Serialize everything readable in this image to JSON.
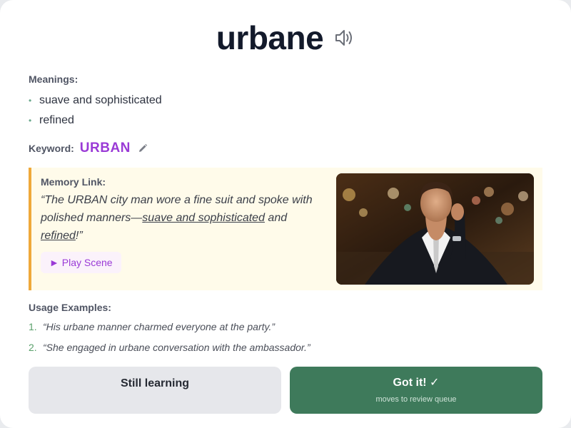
{
  "word": "urbane",
  "meanings_label": "Meanings:",
  "meanings": [
    "suave and sophisticated",
    "refined"
  ],
  "keyword_label": "Keyword:",
  "keyword": "URBAN",
  "memory": {
    "label": "Memory Link:",
    "text_parts": [
      "“The URBAN city man wore a fine suit and spoke with polished manners—",
      "suave and sophisticated",
      " and ",
      "refined",
      "!”"
    ],
    "play_label": "► Play Scene",
    "image_alt": "Man in a dark suit on a city street at night"
  },
  "usage_label": "Usage Examples:",
  "examples": [
    {
      "num": "1.",
      "text": "“His urbane manner charmed everyone at the party.”"
    },
    {
      "num": "2.",
      "text": "“She engaged in urbane conversation with the ambassador.”"
    }
  ],
  "buttons": {
    "still_learning": "Still learning",
    "got_it": "Got it! ✓",
    "got_it_sub": "moves to review queue"
  },
  "colors": {
    "keyword": "#9a3ad6",
    "memory_accent": "#efa93a",
    "got_it_bg": "#3e7a5b"
  }
}
